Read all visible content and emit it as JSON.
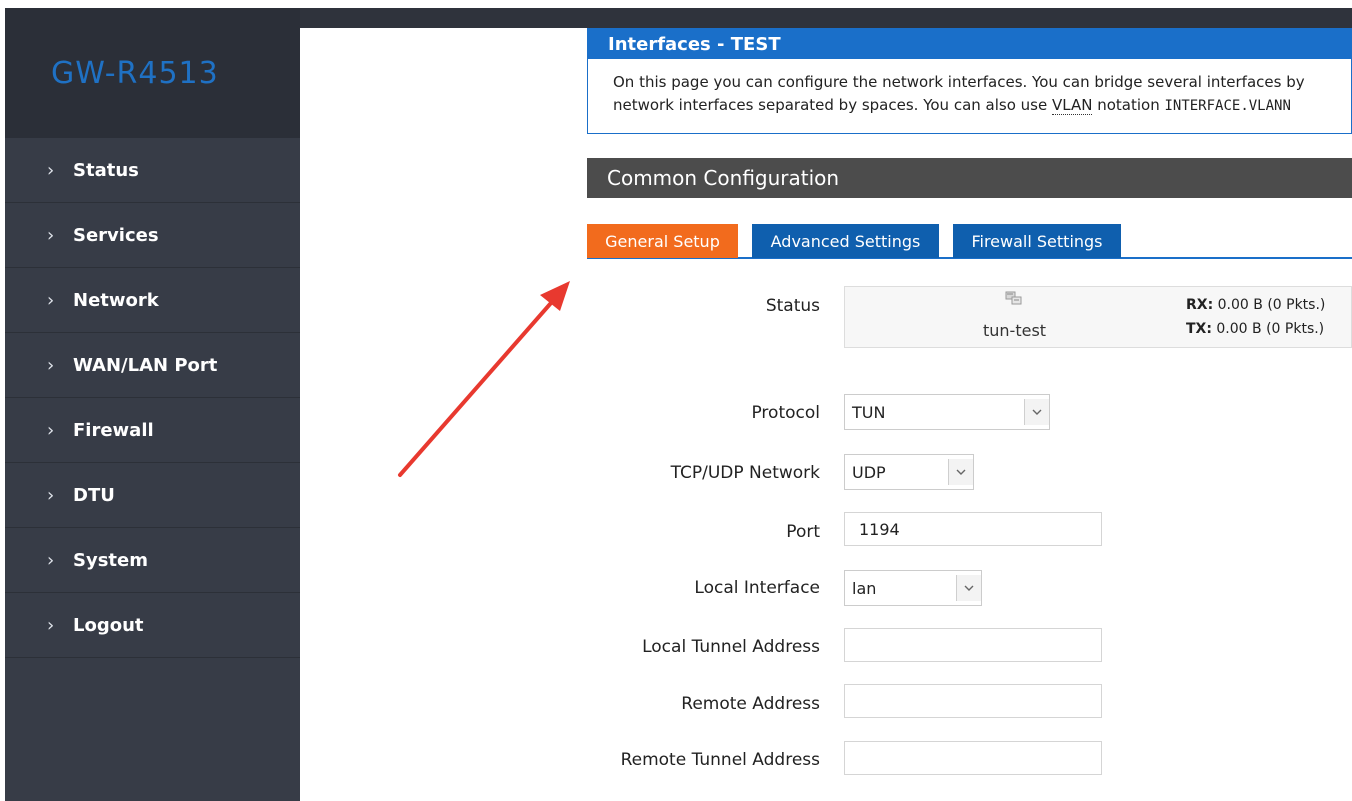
{
  "brand": "GW-R4513",
  "sidebar": {
    "items": [
      {
        "label": "Status"
      },
      {
        "label": "Services"
      },
      {
        "label": "Network"
      },
      {
        "label": "WAN/LAN Port"
      },
      {
        "label": "Firewall"
      },
      {
        "label": "DTU"
      },
      {
        "label": "System"
      },
      {
        "label": "Logout"
      }
    ]
  },
  "info": {
    "title": "Interfaces - TEST",
    "line1": "On this page you can configure the network interfaces. You can bridge several interfaces by",
    "line2_a": "network interfaces separated by spaces. You can also use ",
    "line2_abbr": "VLAN",
    "line2_b": " notation ",
    "line2_mono": "INTERFACE.VLANN"
  },
  "section_title": "Common Configuration",
  "tabs": [
    {
      "label": "General Setup",
      "active": true
    },
    {
      "label": "Advanced Settings",
      "active": false
    },
    {
      "label": "Firewall Settings",
      "active": false
    }
  ],
  "form": {
    "status_label": "Status",
    "status_iface": "tun-test",
    "rx_label": "RX:",
    "rx_value": " 0.00 B (0 Pkts.)",
    "tx_label": "TX:",
    "tx_value": " 0.00 B (0 Pkts.)",
    "protocol_label": "Protocol",
    "protocol_value": "TUN",
    "network_label": "TCP/UDP Network",
    "network_value": "UDP",
    "port_label": "Port",
    "port_value": "1194",
    "local_iface_label": "Local Interface",
    "local_iface_value": "lan",
    "local_tunnel_label": "Local Tunnel Address",
    "local_tunnel_value": "",
    "remote_label": "Remote Address",
    "remote_value": "",
    "remote_tunnel_label": "Remote Tunnel Address",
    "remote_tunnel_value": ""
  },
  "colors": {
    "accent": "#1a6fc9",
    "active_tab": "#f26b1d",
    "sidebar": "#373c47",
    "annotation_arrow": "#e8392f"
  }
}
